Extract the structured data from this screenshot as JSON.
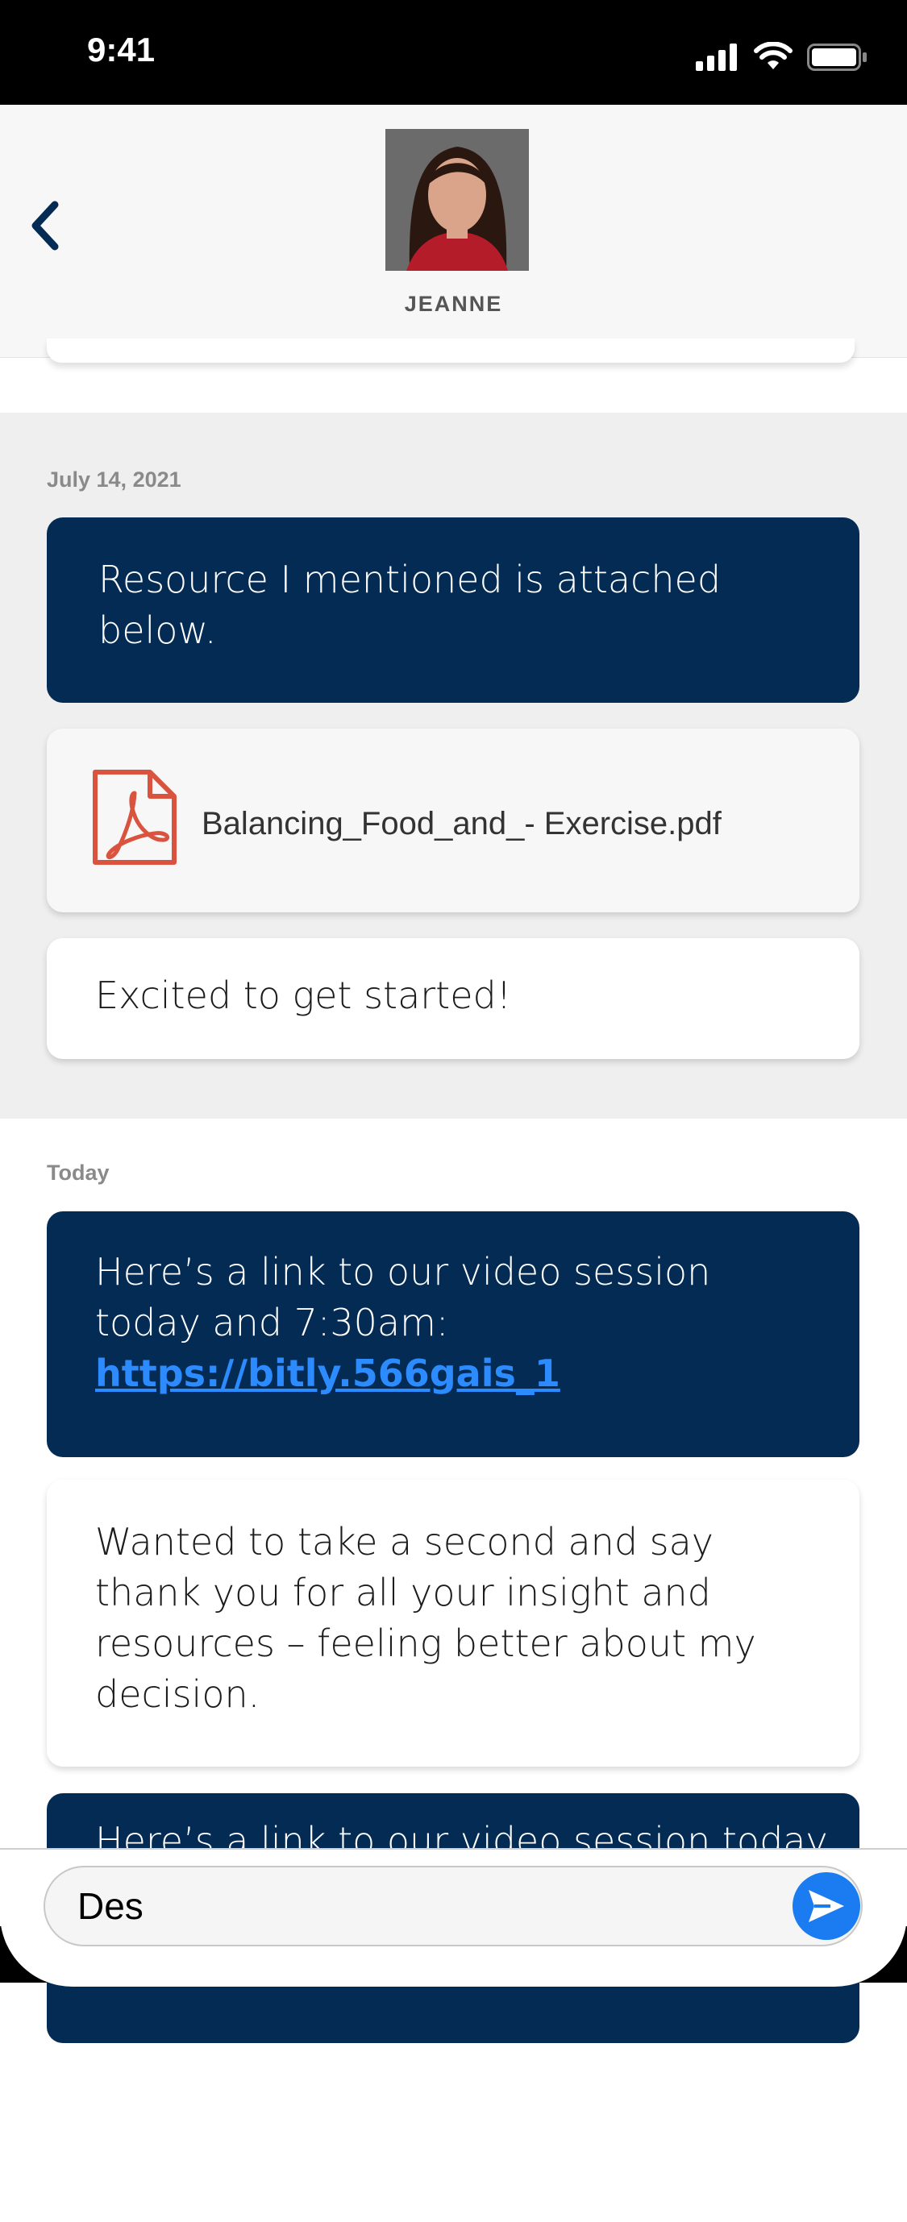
{
  "status_bar": {
    "time": "9:41",
    "icons": [
      "signal-icon",
      "wifi-icon",
      "battery-icon"
    ]
  },
  "header": {
    "back_icon": "chevron-left-icon",
    "contact_name": "JEANNE",
    "avatar": "avatar"
  },
  "conversation": {
    "sections": [
      {
        "date": "July 14, 2021",
        "messages": [
          {
            "type": "sent",
            "text": "Resource I mentioned is attached below."
          },
          {
            "type": "attachment",
            "icon": "pdf-icon",
            "filename": "Balancing_Food_and_- Exercise.pdf"
          },
          {
            "type": "received",
            "text": "Excited to get started!"
          }
        ]
      },
      {
        "date": "Today",
        "messages": [
          {
            "type": "sent",
            "text": "Here’s a link to our video session today and 7:30am:",
            "link": "https://bitly.566gais_1"
          },
          {
            "type": "received",
            "text": "Wanted to take a second and say thank you for all your insight and resources – feeling better about my decision."
          },
          {
            "type": "sent",
            "text": "Here’s a link to our video session today"
          }
        ]
      }
    ]
  },
  "composer": {
    "value": "Des",
    "send_icon": "send-icon"
  },
  "colors": {
    "sent_bubble": "#032b54",
    "link": "#2b8bff",
    "send_button": "#1a7cf0",
    "section_gray": "#efefef"
  }
}
